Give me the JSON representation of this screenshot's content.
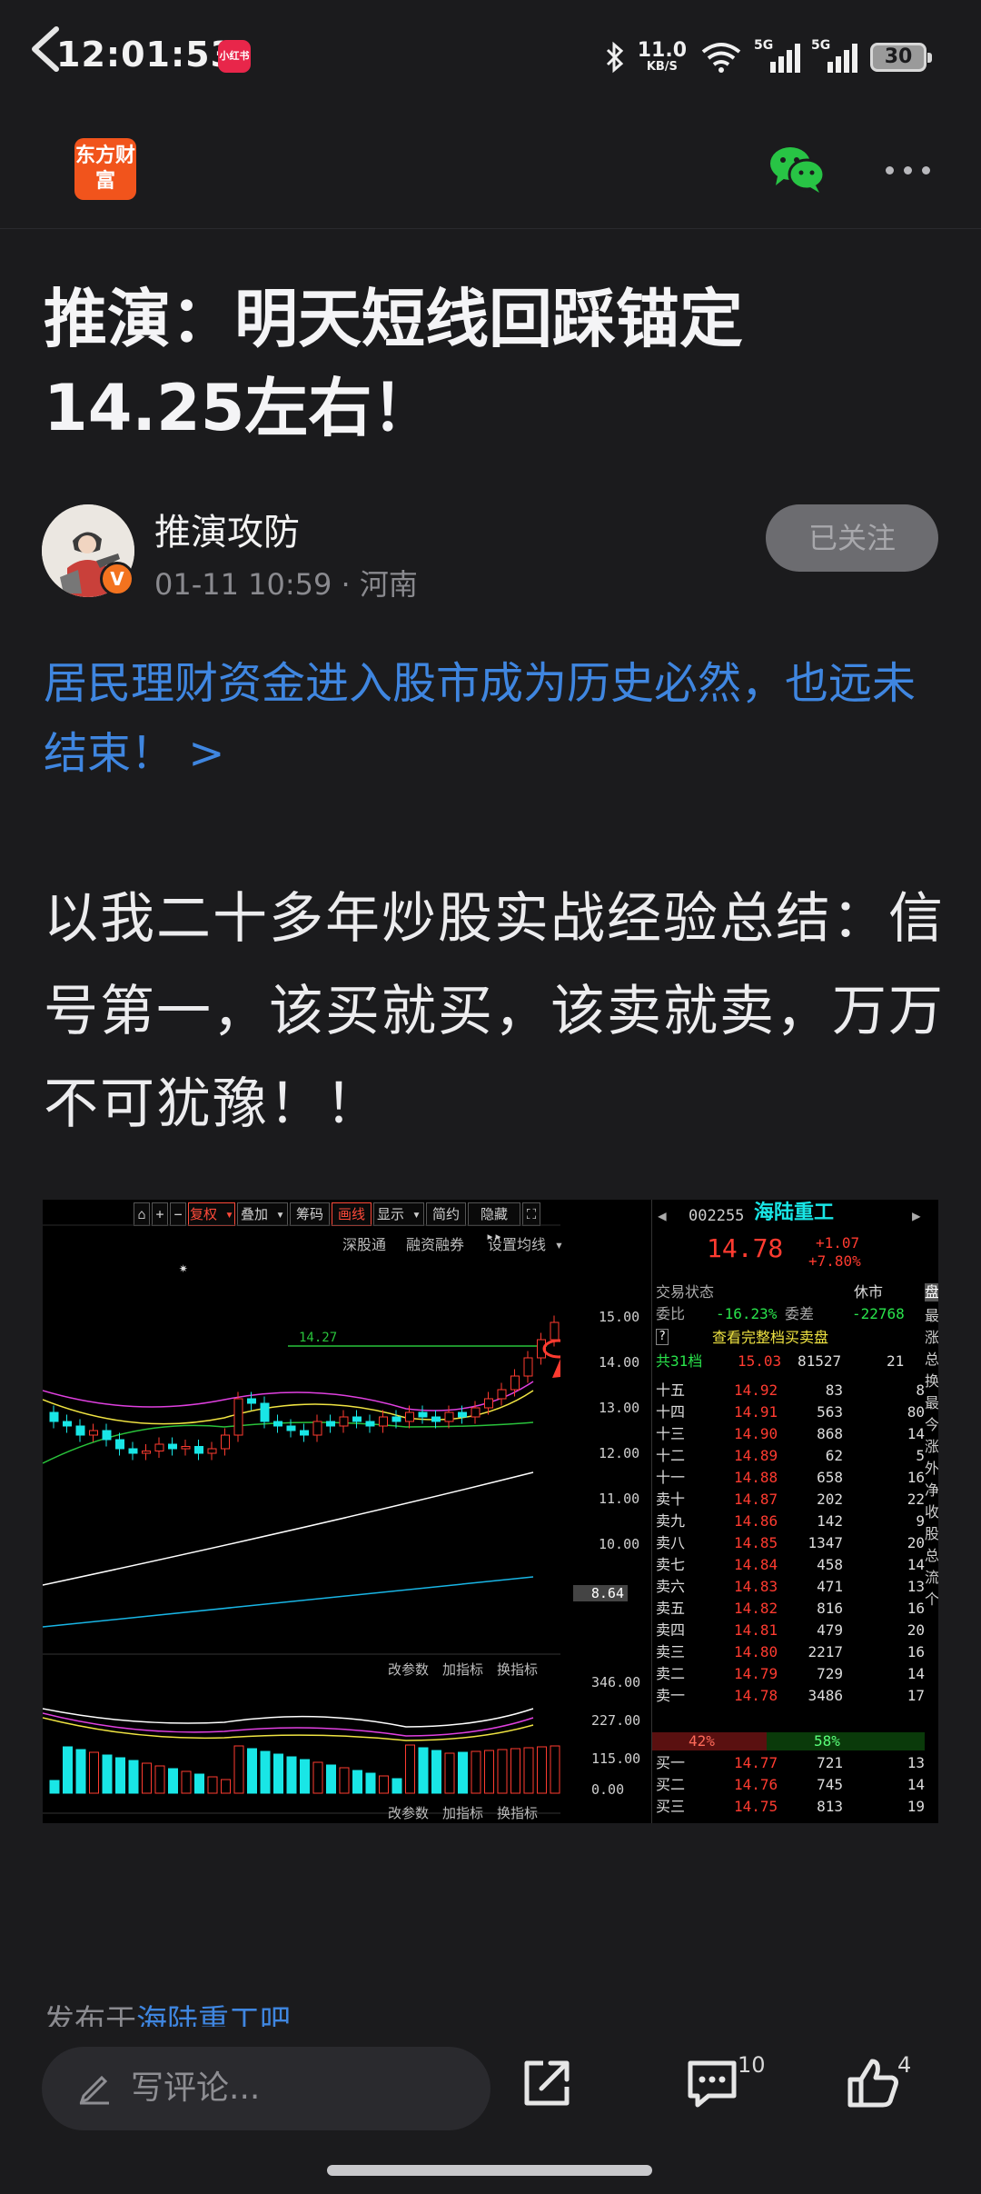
{
  "status_bar": {
    "time": "12:01:53",
    "app_badge": "小红书",
    "speed_value": "11.0",
    "speed_unit": "KB/S",
    "network_1": "5G",
    "network_2": "5G",
    "battery": "30"
  },
  "nav": {
    "logo_text": "东方财富"
  },
  "article": {
    "title": "推演：明天短线回踩锚定14.25左右！",
    "author": "推演攻防",
    "date": "01-11 10:59",
    "location": "· 河南",
    "follow_label": "已关注",
    "promo_link": "居民理财资金进入股市成为历史必然，也远未结束！ >",
    "body": "以我二十多年炒股实战经验总结：信号第一，该买就买，该卖就卖，万万不可犹豫！！",
    "published_prefix": "发布于",
    "published_bar": "海陆重工吧"
  },
  "chart": {
    "toolbar": [
      "复权 ▾",
      "叠加 ▾",
      "筹码",
      "画线",
      "显示 ▾",
      "简约",
      "隐藏 ▸▸"
    ],
    "sub_toolbar": [
      "深股通",
      "融资融券",
      "设置均线 ▾"
    ],
    "indicator_toolbar": [
      "改参数",
      "加指标",
      "换指标"
    ],
    "price_axis": [
      "15.00",
      "14.00",
      "13.00",
      "12.00",
      "11.00",
      "10.00"
    ],
    "price_low": "8.64",
    "vol_axis": [
      "346.00",
      "227.00",
      "115.00",
      "0.00"
    ],
    "anchor_line_label": "14.27",
    "stock_code": "002255",
    "stock_name": "海陆重工",
    "price": "14.78",
    "change": "+1.07",
    "change_pct": "+7.80%",
    "trade_status_label": "交易状态",
    "trade_status": "休市",
    "weibi_label": "委比",
    "weibi": "-16.23%",
    "weicha_label": "委差",
    "weicha": "-22768",
    "full_orderbook": "查看完整档买卖盘",
    "total_levels_label": "共31档",
    "total_price": "15.03",
    "total_vol": "81527",
    "total_cnt": "21",
    "asks": [
      {
        "label": "十五",
        "price": "14.92",
        "vol": "83",
        "n": "8"
      },
      {
        "label": "十四",
        "price": "14.91",
        "vol": "563",
        "n": "80"
      },
      {
        "label": "十三",
        "price": "14.90",
        "vol": "868",
        "n": "14"
      },
      {
        "label": "十二",
        "price": "14.89",
        "vol": "62",
        "n": "5"
      },
      {
        "label": "十一",
        "price": "14.88",
        "vol": "658",
        "n": "16"
      },
      {
        "label": "卖十",
        "price": "14.87",
        "vol": "202",
        "n": "22"
      },
      {
        "label": "卖九",
        "price": "14.86",
        "vol": "142",
        "n": "9"
      },
      {
        "label": "卖八",
        "price": "14.85",
        "vol": "1347",
        "n": "20"
      },
      {
        "label": "卖七",
        "price": "14.84",
        "vol": "458",
        "n": "14"
      },
      {
        "label": "卖六",
        "price": "14.83",
        "vol": "471",
        "n": "13"
      },
      {
        "label": "卖五",
        "price": "14.82",
        "vol": "816",
        "n": "16"
      },
      {
        "label": "卖四",
        "price": "14.81",
        "vol": "479",
        "n": "20"
      },
      {
        "label": "卖三",
        "price": "14.80",
        "vol": "2217",
        "n": "16"
      },
      {
        "label": "卖二",
        "price": "14.79",
        "vol": "729",
        "n": "14"
      },
      {
        "label": "卖一",
        "price": "14.78",
        "vol": "3486",
        "n": "17"
      }
    ],
    "sell_pct": "42%",
    "buy_pct": "58%",
    "bids": [
      {
        "label": "买一",
        "price": "14.77",
        "vol": "721",
        "n": "13"
      },
      {
        "label": "买二",
        "price": "14.76",
        "vol": "745",
        "n": "14"
      },
      {
        "label": "买三",
        "price": "14.75",
        "vol": "813",
        "n": "19"
      }
    ],
    "side_tab": "盘",
    "side_labels": [
      "最",
      "涨",
      "总",
      "换",
      "最",
      "今",
      "涨",
      "外",
      "净",
      "收",
      "股",
      "总",
      "流",
      "个"
    ]
  },
  "bottom_bar": {
    "comment_placeholder": "写评论...",
    "comment_count": "10",
    "like_count": "4"
  },
  "colors": {
    "accent_blue": "#3f86e0",
    "brand_orange": "#f1541c",
    "rise_red": "#ff3b30",
    "fall_cyan": "#19e6e6"
  }
}
